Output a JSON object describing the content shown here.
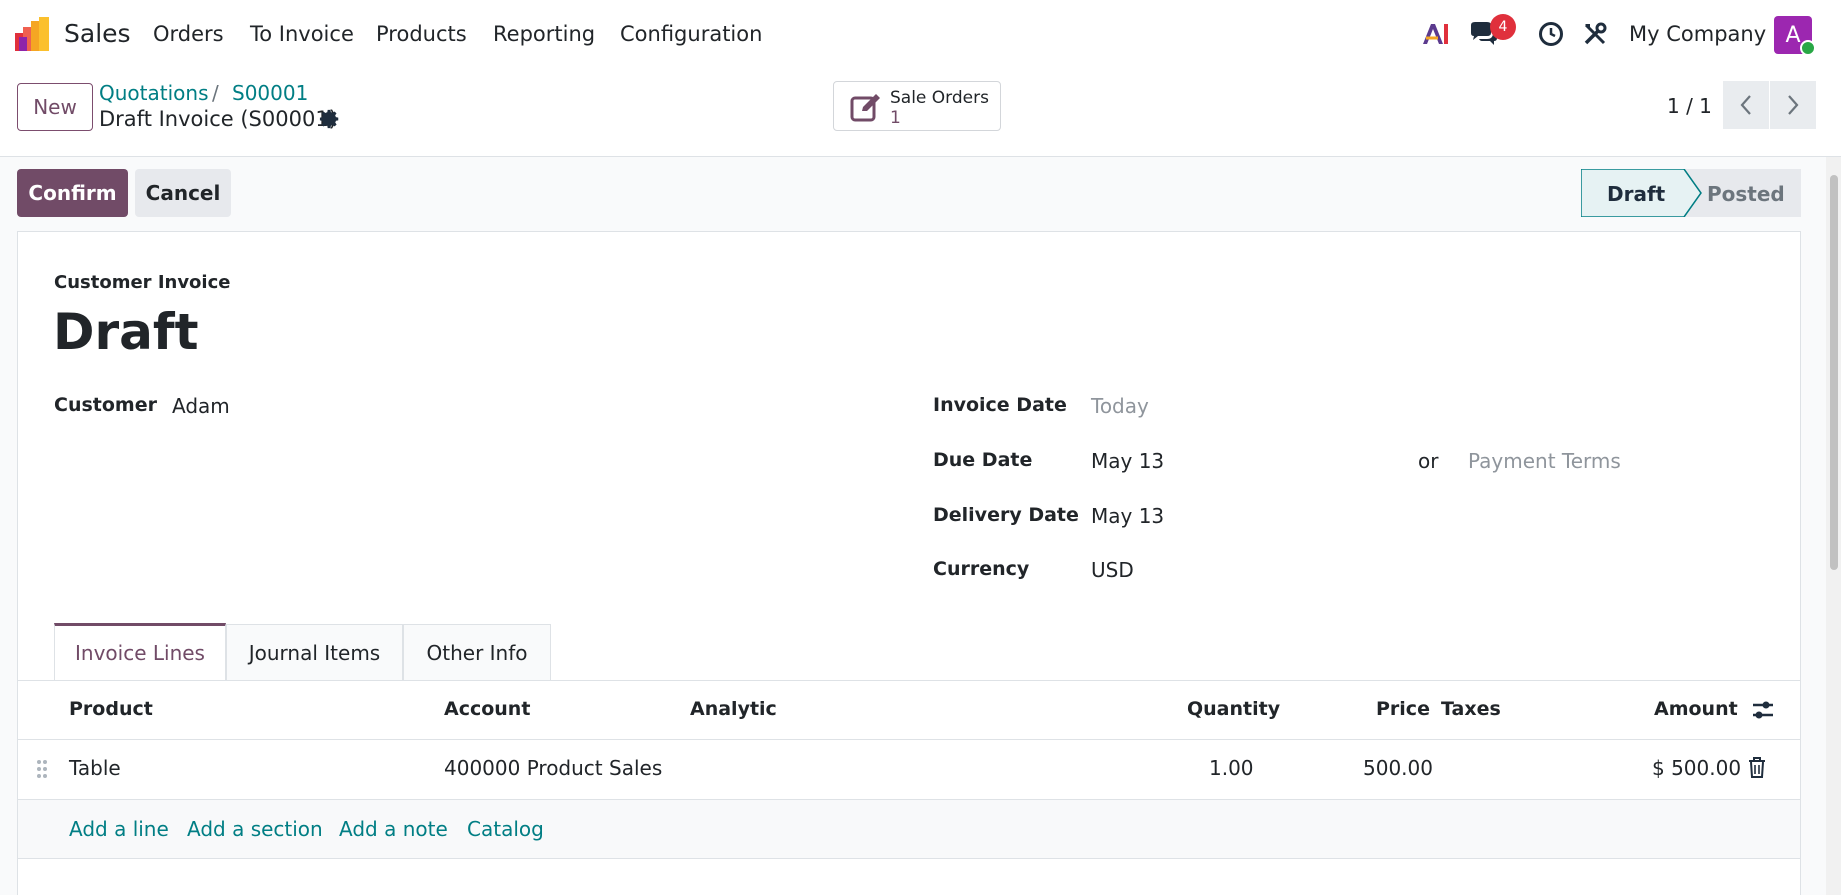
{
  "navbar": {
    "app_name": "Sales",
    "menu": [
      "Orders",
      "To Invoice",
      "Products",
      "Reporting",
      "Configuration"
    ],
    "messages_badge": "4",
    "company": "My Company",
    "avatar_letter": "A"
  },
  "control_panel": {
    "new_label": "New",
    "breadcrumb": [
      "Quotations",
      "S00001"
    ],
    "breadcrumb_separator": "/",
    "current_record": "Draft Invoice (S00001)",
    "smart_button": {
      "label": "Sale Orders",
      "count": "1"
    },
    "pager": "1 / 1"
  },
  "statusbar": {
    "confirm_label": "Confirm",
    "cancel_label": "Cancel",
    "stages": [
      "Draft",
      "Posted"
    ],
    "active_stage": "Draft"
  },
  "form": {
    "doc_type": "Customer Invoice",
    "title": "Draft",
    "customer_label": "Customer",
    "customer_value": "Adam",
    "invoice_date_label": "Invoice Date",
    "invoice_date_placeholder": "Today",
    "due_date_label": "Due Date",
    "due_date_value": "May 13",
    "or_label": "or",
    "payment_terms_placeholder": "Payment Terms",
    "delivery_date_label": "Delivery Date",
    "delivery_date_value": "May 13",
    "currency_label": "Currency",
    "currency_value": "USD"
  },
  "tabs": [
    "Invoice Lines",
    "Journal Items",
    "Other Info"
  ],
  "table": {
    "headers": [
      "Product",
      "Account",
      "Analytic",
      "Quantity",
      "Price",
      "Taxes",
      "Amount"
    ],
    "rows": [
      {
        "product": "Table",
        "account": "400000 Product Sales",
        "analytic": "",
        "quantity": "1.00",
        "price": "500.00",
        "taxes": "",
        "amount": "$ 500.00"
      }
    ],
    "add_links": [
      "Add a line",
      "Add a section",
      "Add a note",
      "Catalog"
    ]
  },
  "colors": {
    "brand": "#714b67",
    "link": "#017e84",
    "badge": "#e0303c"
  }
}
